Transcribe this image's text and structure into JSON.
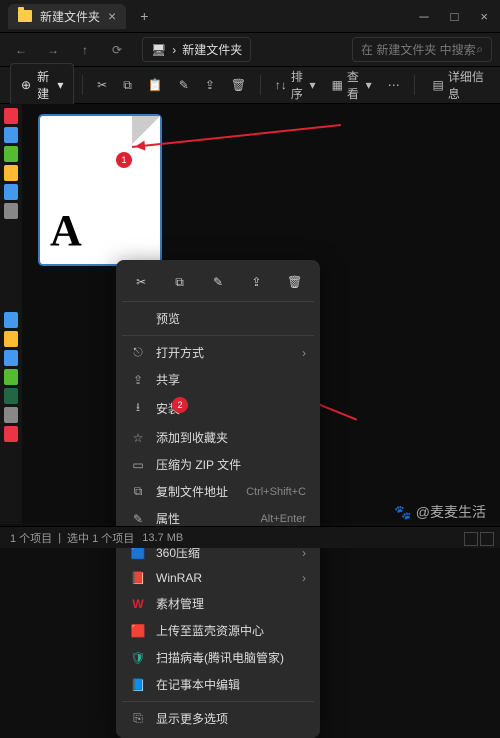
{
  "titlebar": {
    "tab_title": "新建文件夹",
    "close": "×",
    "min": "─",
    "max": "□",
    "add": "+"
  },
  "addr": {
    "back": "←",
    "fwd": "→",
    "up": "↑",
    "refresh": "⟳",
    "monitor": "🖥",
    "chev": "›",
    "folder": "新建文件夹"
  },
  "search": {
    "placeholder": "在 新建文件夹 中搜索",
    "icon": "⌕"
  },
  "toolbar": {
    "new": "新建",
    "new_icon": "⊕",
    "cut": "✂",
    "copy": "⧉",
    "paste": "📋",
    "rename": "✎",
    "share": "⇪",
    "delete": "🗑",
    "sort": "排序",
    "sort_icon": "↑↓",
    "view": "查看",
    "view_icon": "▦",
    "more": "⋯",
    "details": "详细信息",
    "details_icon": "▤"
  },
  "file": {
    "glyph": "A"
  },
  "badges": {
    "one": "1",
    "two": "2"
  },
  "ctx_icons": {
    "cut": "✂",
    "copy": "⧉",
    "rename": "✎",
    "share": "⇪",
    "delete": "🗑"
  },
  "menu": {
    "preview": "预览",
    "openwith": "打开方式",
    "openwith_ic": "⎋",
    "share": "共享",
    "share_ic": "⇪",
    "install": "安装",
    "install_ic": "⭳",
    "fav": "添加到收藏夹",
    "fav_ic": "☆",
    "zip": "压缩为 ZIP 文件",
    "zip_ic": "▭",
    "copypath": "复制文件地址",
    "copypath_ic": "⧉",
    "copypath_kb": "Ctrl+Shift+C",
    "props": "属性",
    "props_ic": "✎",
    "props_kb": "Alt+Enter",
    "m360": "360压缩",
    "m360_ic": "🟦",
    "winrar": "WinRAR",
    "winrar_ic": "📕",
    "sucai": "素材管理",
    "sucai_ic": "W",
    "upload": "上传至蓝壳资源中心",
    "upload_ic": "🟥",
    "scan": "扫描病毒(腾讯电脑管家)",
    "scan_ic": "🛡",
    "notepad": "在记事本中编辑",
    "notepad_ic": "📘",
    "more": "显示更多选项",
    "more_ic": "⎘"
  },
  "watermark": "@麦麦生活",
  "watermark_ic": "🐾",
  "status": {
    "items": "1 个项目",
    "sel": "选中 1 个项目",
    "size": "13.7 MB"
  }
}
